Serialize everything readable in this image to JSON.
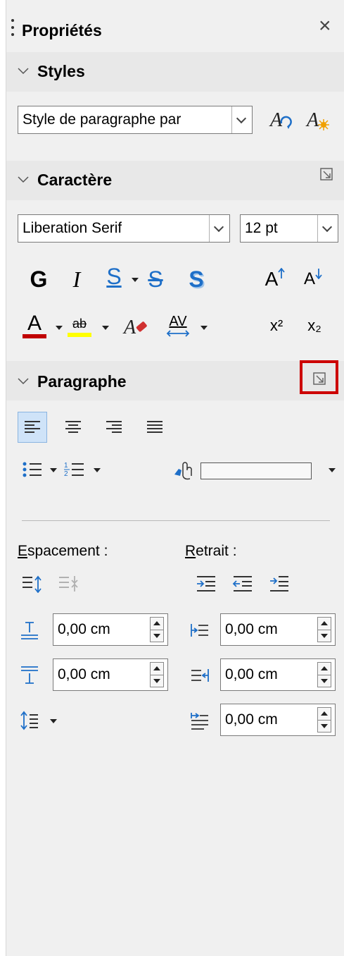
{
  "panel": {
    "title": "Propriétés",
    "close_glyph": "×"
  },
  "styles": {
    "title": "Styles",
    "paragraph_style": "Style de paragraphe par"
  },
  "character": {
    "title": "Caractère",
    "font_name": "Liberation Serif",
    "font_size": "12 pt",
    "bold_label": "G",
    "italic_label": "I",
    "underline_label": "S",
    "strike_label": "S",
    "shadow_label": "S",
    "grow_label": "A",
    "shrink_label": "A",
    "font_color_label": "A",
    "highlight_label": "ab",
    "spacing_label": "AV",
    "superscript_label": "x²",
    "subscript_label": "x₂",
    "font_color": "#c00000",
    "highlight_color": "#ffff00"
  },
  "paragraph": {
    "title": "Paragraphe",
    "spacing_label_first": "E",
    "spacing_label_rest": "spacement :",
    "indent_label_first": "R",
    "indent_label_rest": "etrait :",
    "above_spacing": "0,00 cm",
    "below_spacing": "0,00 cm",
    "before_indent": "0,00 cm",
    "after_indent": "0,00 cm",
    "first_line_indent": "0,00 cm"
  },
  "colors": {
    "highlight_box": "#cc0000",
    "accent_blue": "#1e6fc8",
    "align_active_bg": "#cfe3f8"
  }
}
